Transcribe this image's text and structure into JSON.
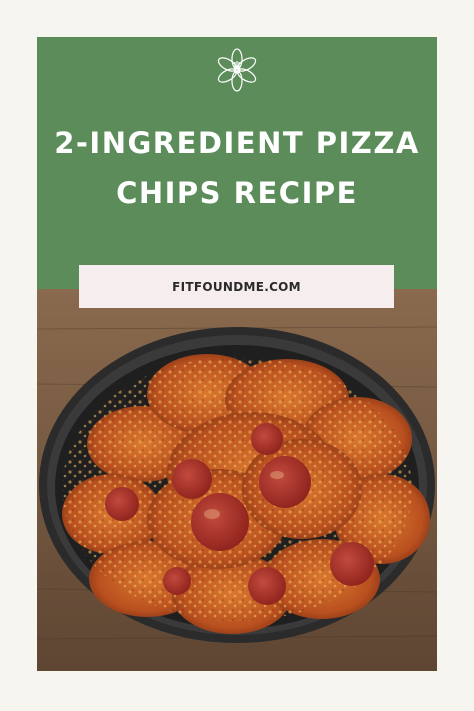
{
  "title": {
    "line1": "2-INGREDIENT PIZZA",
    "line2": "CHIPS RECIPE"
  },
  "site": {
    "label": "FITFOUNDME.COM"
  },
  "icons": {
    "flower": "flower-icon"
  },
  "colors": {
    "page_background": "#f6f5ef",
    "header_green": "#5b8c5a",
    "banner_pink": "#f6eeee",
    "title_text": "#ffffff"
  }
}
